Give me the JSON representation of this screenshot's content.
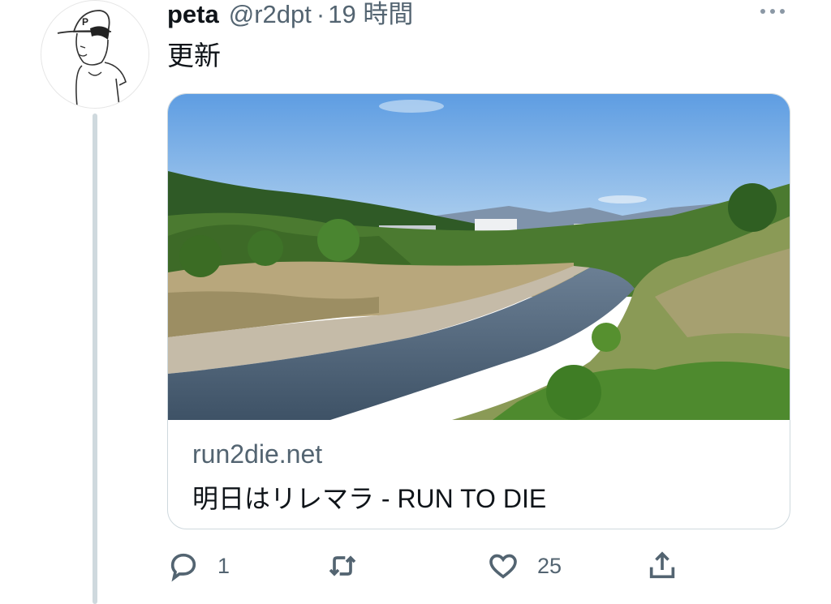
{
  "author": {
    "name": "peta",
    "handle": "@r2dpt",
    "separator": "·",
    "time": "19 時間"
  },
  "tweet": {
    "text": "更新"
  },
  "card": {
    "domain": "run2die.net",
    "title": "明日はリレマラ - RUN TO DIE"
  },
  "actions": {
    "reply_count": "1",
    "retweet_count": "",
    "like_count": "25"
  },
  "icons": {
    "more": "more-horizontal-icon",
    "reply": "reply-icon",
    "retweet": "retweet-icon",
    "like": "heart-icon",
    "share": "share-icon"
  }
}
